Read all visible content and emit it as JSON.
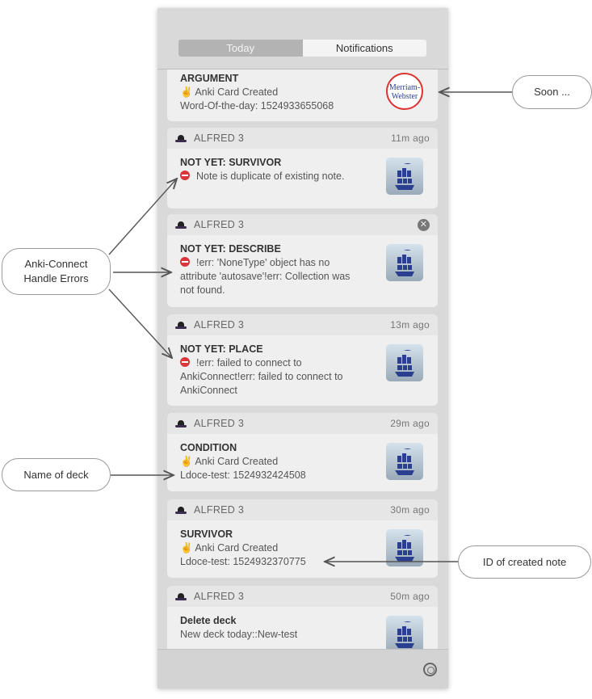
{
  "tabs": {
    "today": "Today",
    "notifications": "Notifications"
  },
  "first": {
    "title": "ARGUMENT",
    "line1": "✌️ Anki Card Created",
    "line2": "Word-Of-the-day: 1524933655068",
    "logo": "Merriam-Webster"
  },
  "notifications": [
    {
      "app": "ALFRED 3",
      "time": "11m ago",
      "title": "NOT YET: SURVIVOR",
      "body": "Note is duplicate of existing note.",
      "error": true
    },
    {
      "app": "ALFRED 3",
      "time": "",
      "title": "NOT YET: DESCRIBE",
      "body": "!err: 'NoneType' object has no attribute 'autosave'!err: Collection was not found.",
      "error": true
    },
    {
      "app": "ALFRED 3",
      "time": "13m ago",
      "title": "NOT YET: PLACE",
      "body": "!err: failed to connect to AnkiConnect!err: failed to connect to AnkiConnect",
      "error": true
    },
    {
      "app": "ALFRED 3",
      "time": "29m ago",
      "title": "CONDITION",
      "line1": "✌️ Anki Card Created",
      "line2": "Ldoce-test: 1524932424508"
    },
    {
      "app": "ALFRED 3",
      "time": "30m ago",
      "title": "SURVIVOR",
      "line1": "✌️ Anki Card Created",
      "line2": "Ldoce-test: 1524932370775"
    },
    {
      "app": "ALFRED 3",
      "time": "50m ago",
      "title": "Delete deck",
      "line2": "New deck today::New-test"
    }
  ],
  "callouts": {
    "soon": "Soon ...",
    "errors": "Anki-Connect Handle Errors",
    "deck": "Name of deck",
    "note_id": "ID of created note"
  }
}
